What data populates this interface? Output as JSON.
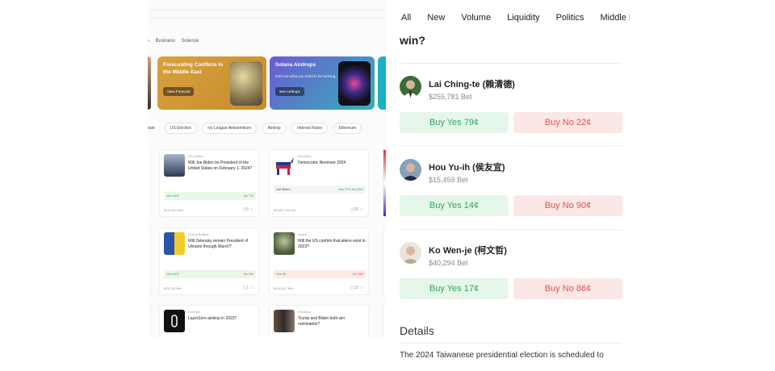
{
  "left_panel": {
    "categories": [
      "Business",
      "Science"
    ],
    "banners": [
      {
        "title": "Forecasting Conflicts in the Middle East",
        "subtitle": "",
        "button": "View Forecast"
      },
      {
        "title": "Solana Airdrops",
        "subtitle": "Find out what you need to be farming",
        "button": "See Airdrops"
      }
    ],
    "tags": [
      "rael",
      "US Election",
      "Ivy League Antisemitism",
      "Airdrop",
      "Interest Rates",
      "Ethereum"
    ],
    "cards": [
      {
        "category": "US politics",
        "title": "Will Joe Biden be President of the United States on February 1, 2024?",
        "bar": "Yes 93%",
        "bar_right": "No 7%",
        "volume": "$220,654 Bet",
        "comments": "5"
      },
      {
        "category": "Elections",
        "title": "Democratic Nominee 2024",
        "bar": "Joe Biden",
        "bar_right": "Yes 77%   No 23%",
        "volume": "$2,692,733 Bet",
        "comments": "26"
      },
      {
        "category": "Global Politics",
        "title": "Will Zelensky remain President of Ukraine through March?",
        "bar": "Yes 92%",
        "bar_right": "No 8%",
        "volume": "$25,753 Bet",
        "comments": "1"
      },
      {
        "category": "Space",
        "title": "Will the US confirm that aliens exist in 2023?",
        "bar": "Yes 2¢",
        "bar_right": "No 98¢",
        "volume": "$100,907 Bet",
        "comments": "13"
      },
      {
        "category": "Airdrops",
        "title": "LayerZero airdrop in 2023?",
        "bar": "",
        "bar_right": "",
        "volume": "",
        "comments": ""
      },
      {
        "category": "Elections",
        "title": "Trump and Biden both win nomination?",
        "bar": "",
        "bar_right": "",
        "volume": "",
        "comments": ""
      }
    ]
  },
  "right_panel": {
    "tabs": [
      "All",
      "New",
      "Volume",
      "Liquidity",
      "Politics",
      "Middle East"
    ],
    "question_tail": "win?",
    "candidates": [
      {
        "name": "Lai Ching-te (賴清德)",
        "bet": "$255,781 Bet",
        "yes": "Buy Yes 79¢",
        "no": "Buy No 22¢"
      },
      {
        "name": "Hou Yu-ih (侯友宜)",
        "bet": "$15,459 Bet",
        "yes": "Buy Yes 14¢",
        "no": "Buy No 90¢"
      },
      {
        "name": "Ko Wen-je (柯文哲)",
        "bet": "$40,294 Bet",
        "yes": "Buy Yes 17¢",
        "no": "Buy No 86¢"
      }
    ],
    "details_title": "Details",
    "details_text": "The 2024 Taiwanese presidential election is scheduled to"
  },
  "colors": {
    "yes_bg": "#e5f6ea",
    "yes_text": "#2fa55a",
    "no_bg": "#fbe7e5",
    "no_text": "#d9534f"
  }
}
